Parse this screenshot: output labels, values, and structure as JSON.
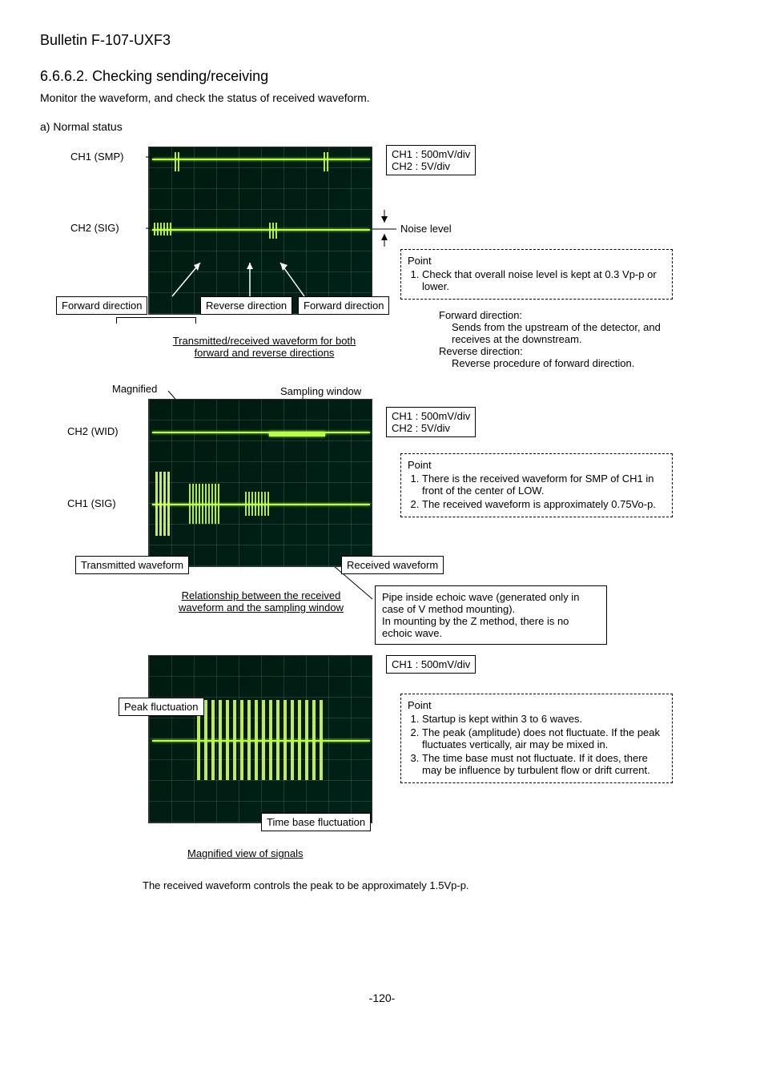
{
  "header": {
    "bulletin": "Bulletin F-107-UXF3"
  },
  "section": {
    "number": "6.6.6.2.",
    "title": "Checking sending/receiving",
    "intro": "Monitor the waveform, and check the status of received waveform.",
    "normal_status": "a)  Normal status"
  },
  "scope1": {
    "ch1_div": "CH1 : 500mV/div",
    "ch2_div": "CH2 : 5V/div",
    "ch1_label": "CH1 (SMP)",
    "ch2_label": "CH2 (SIG)",
    "noise_level": "Noise level",
    "fwd1": "Forward direction",
    "rev": "Reverse direction",
    "fwd2": "Forward direction",
    "caption": "Transmitted/received waveform for both forward and reverse directions",
    "point": {
      "title": "Point",
      "items": [
        "Check that overall noise level is kept at 0.3 Vp-p or lower."
      ]
    }
  },
  "directions": {
    "fwd_label": "Forward direction:",
    "fwd_text": "Sends from the upstream of the detector, and receives at the downstream.",
    "rev_label": "Reverse direction:",
    "rev_text": "Reverse procedure of forward direction."
  },
  "scope2": {
    "magnified": "Magnified",
    "sampling_window": "Sampling window",
    "ch1_div": "CH1 : 500mV/div",
    "ch2_div": "CH2 : 5V/div",
    "ch2_label": "CH2 (WID)",
    "ch1_label": "CH1 (SIG)",
    "transmitted": "Transmitted waveform",
    "received": "Received waveform",
    "caption": "Relationship between the received waveform and the sampling window",
    "point": {
      "title": "Point",
      "items": [
        "There is the received waveform for SMP of CH1 in front of the center of LOW.",
        "The received waveform is approximately 0.75Vo-p."
      ]
    }
  },
  "echoic": {
    "text1": "Pipe inside echoic wave (generated only in case of V method mounting).",
    "text2": "In mounting by the Z method, there is no echoic wave."
  },
  "scope3": {
    "ch1_div": "CH1 : 500mV/div",
    "peak_fluct": "Peak fluctuation",
    "time_base": "Time base fluctuation",
    "caption": "Magnified view of signals",
    "point": {
      "title": "Point",
      "items": [
        "Startup is kept within 3 to 6 waves.",
        "The peak (amplitude) does not fluctuate. If the peak fluctuates vertically, air may be mixed in.",
        "The time base must not fluctuate. If it does, there may be influence by turbulent flow or drift current."
      ]
    }
  },
  "footer_note": "The received waveform controls the peak to be approximately 1.5Vp-p.",
  "page_number": "-120-"
}
